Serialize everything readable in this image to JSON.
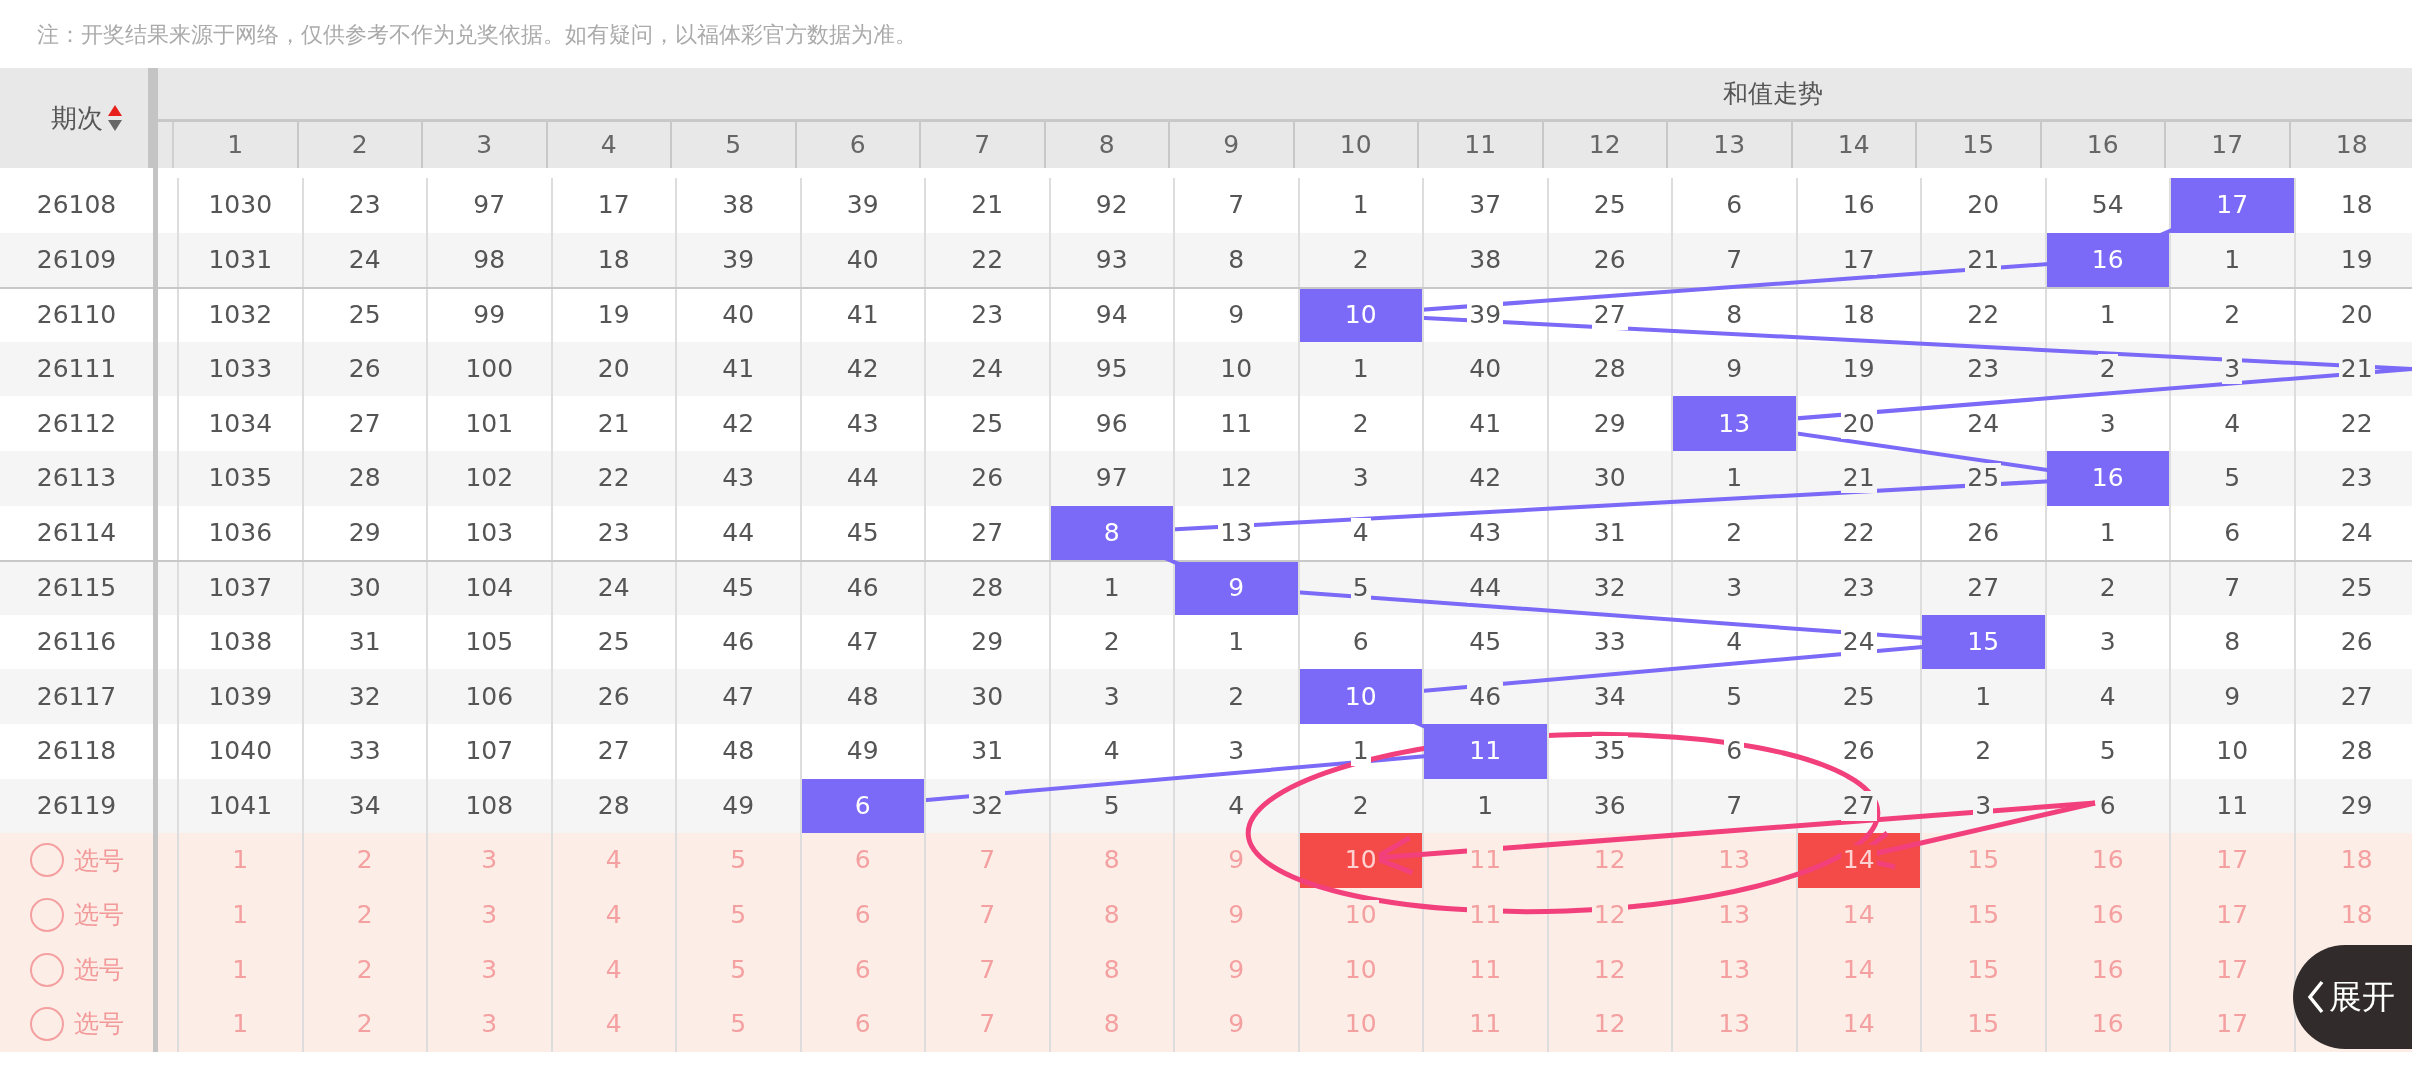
{
  "notice": "注：开奖结果来源于网络，仅供参考不作为兑奖依据。如有疑问，以福体彩官方数据为准。",
  "header": {
    "period_label": "期次",
    "sort_ascending": true,
    "group_title": "和值走势",
    "columns": [
      "1",
      "2",
      "3",
      "4",
      "5",
      "6",
      "7",
      "8",
      "9",
      "10",
      "11",
      "12",
      "13",
      "14",
      "15",
      "16",
      "17",
      "18"
    ]
  },
  "rows": [
    {
      "period": "26108",
      "separator_above": false,
      "cells": [
        "1030",
        "23",
        "97",
        "17",
        "38",
        "39",
        "21",
        "92",
        "7",
        "1",
        "37",
        "25",
        "6",
        "16",
        "20",
        "54",
        "17",
        "18"
      ],
      "hits": [
        false,
        false,
        false,
        false,
        false,
        false,
        false,
        false,
        false,
        false,
        false,
        false,
        false,
        false,
        false,
        false,
        true,
        false
      ]
    },
    {
      "period": "26109",
      "separator_above": false,
      "cells": [
        "1031",
        "24",
        "98",
        "18",
        "39",
        "40",
        "22",
        "93",
        "8",
        "2",
        "38",
        "26",
        "7",
        "17",
        "21",
        "16",
        "1",
        "19"
      ],
      "hits": [
        false,
        false,
        false,
        false,
        false,
        false,
        false,
        false,
        false,
        false,
        false,
        false,
        false,
        false,
        false,
        true,
        false,
        false
      ]
    },
    {
      "period": "26110",
      "separator_above": true,
      "cells": [
        "1032",
        "25",
        "99",
        "19",
        "40",
        "41",
        "23",
        "94",
        "9",
        "10",
        "39",
        "27",
        "8",
        "18",
        "22",
        "1",
        "2",
        "20"
      ],
      "hits": [
        false,
        false,
        false,
        false,
        false,
        false,
        false,
        false,
        false,
        true,
        false,
        false,
        false,
        false,
        false,
        false,
        false,
        false
      ]
    },
    {
      "period": "26111",
      "separator_above": false,
      "cells": [
        "1033",
        "26",
        "100",
        "20",
        "41",
        "42",
        "24",
        "95",
        "10",
        "1",
        "40",
        "28",
        "9",
        "19",
        "23",
        "2",
        "3",
        "21"
      ],
      "hits": [
        false,
        false,
        false,
        false,
        false,
        false,
        false,
        false,
        false,
        false,
        false,
        false,
        false,
        false,
        false,
        false,
        false,
        false
      ]
    },
    {
      "period": "26112",
      "separator_above": false,
      "cells": [
        "1034",
        "27",
        "101",
        "21",
        "42",
        "43",
        "25",
        "96",
        "11",
        "2",
        "41",
        "29",
        "13",
        "20",
        "24",
        "3",
        "4",
        "22"
      ],
      "hits": [
        false,
        false,
        false,
        false,
        false,
        false,
        false,
        false,
        false,
        false,
        false,
        false,
        true,
        false,
        false,
        false,
        false,
        false
      ]
    },
    {
      "period": "26113",
      "separator_above": false,
      "cells": [
        "1035",
        "28",
        "102",
        "22",
        "43",
        "44",
        "26",
        "97",
        "12",
        "3",
        "42",
        "30",
        "1",
        "21",
        "25",
        "16",
        "5",
        "23"
      ],
      "hits": [
        false,
        false,
        false,
        false,
        false,
        false,
        false,
        false,
        false,
        false,
        false,
        false,
        false,
        false,
        false,
        true,
        false,
        false
      ]
    },
    {
      "period": "26114",
      "separator_above": false,
      "cells": [
        "1036",
        "29",
        "103",
        "23",
        "44",
        "45",
        "27",
        "8",
        "13",
        "4",
        "43",
        "31",
        "2",
        "22",
        "26",
        "1",
        "6",
        "24"
      ],
      "hits": [
        false,
        false,
        false,
        false,
        false,
        false,
        false,
        true,
        false,
        false,
        false,
        false,
        false,
        false,
        false,
        false,
        false,
        false
      ]
    },
    {
      "period": "26115",
      "separator_above": true,
      "cells": [
        "1037",
        "30",
        "104",
        "24",
        "45",
        "46",
        "28",
        "1",
        "9",
        "5",
        "44",
        "32",
        "3",
        "23",
        "27",
        "2",
        "7",
        "25"
      ],
      "hits": [
        false,
        false,
        false,
        false,
        false,
        false,
        false,
        false,
        true,
        false,
        false,
        false,
        false,
        false,
        false,
        false,
        false,
        false
      ]
    },
    {
      "period": "26116",
      "separator_above": false,
      "cells": [
        "1038",
        "31",
        "105",
        "25",
        "46",
        "47",
        "29",
        "2",
        "1",
        "6",
        "45",
        "33",
        "4",
        "24",
        "15",
        "3",
        "8",
        "26"
      ],
      "hits": [
        false,
        false,
        false,
        false,
        false,
        false,
        false,
        false,
        false,
        false,
        false,
        false,
        false,
        false,
        true,
        false,
        false,
        false
      ]
    },
    {
      "period": "26117",
      "separator_above": false,
      "cells": [
        "1039",
        "32",
        "106",
        "26",
        "47",
        "48",
        "30",
        "3",
        "2",
        "10",
        "46",
        "34",
        "5",
        "25",
        "1",
        "4",
        "9",
        "27"
      ],
      "hits": [
        false,
        false,
        false,
        false,
        false,
        false,
        false,
        false,
        false,
        true,
        false,
        false,
        false,
        false,
        false,
        false,
        false,
        false
      ]
    },
    {
      "period": "26118",
      "separator_above": false,
      "cells": [
        "1040",
        "33",
        "107",
        "27",
        "48",
        "49",
        "31",
        "4",
        "3",
        "1",
        "11",
        "35",
        "6",
        "26",
        "2",
        "5",
        "10",
        "28"
      ],
      "hits": [
        false,
        false,
        false,
        false,
        false,
        false,
        false,
        false,
        false,
        false,
        true,
        false,
        false,
        false,
        false,
        false,
        false,
        false
      ]
    },
    {
      "period": "26119",
      "separator_above": false,
      "cells": [
        "1041",
        "34",
        "108",
        "28",
        "49",
        "6",
        "32",
        "5",
        "4",
        "2",
        "1",
        "36",
        "7",
        "27",
        "3",
        "6",
        "11",
        "29"
      ],
      "hits": [
        false,
        false,
        false,
        false,
        false,
        true,
        false,
        false,
        false,
        false,
        false,
        false,
        false,
        false,
        false,
        false,
        false,
        false
      ]
    }
  ],
  "pick_rows": [
    {
      "label": "选号",
      "checked": false,
      "numbers": [
        "1",
        "2",
        "3",
        "4",
        "5",
        "6",
        "7",
        "8",
        "9",
        "10",
        "11",
        "12",
        "13",
        "14",
        "15",
        "16",
        "17",
        "18"
      ],
      "selected": [
        false,
        false,
        false,
        false,
        false,
        false,
        false,
        false,
        false,
        true,
        false,
        false,
        false,
        true,
        false,
        false,
        false,
        false
      ]
    },
    {
      "label": "选号",
      "checked": false,
      "numbers": [
        "1",
        "2",
        "3",
        "4",
        "5",
        "6",
        "7",
        "8",
        "9",
        "10",
        "11",
        "12",
        "13",
        "14",
        "15",
        "16",
        "17",
        "18"
      ],
      "selected": [
        false,
        false,
        false,
        false,
        false,
        false,
        false,
        false,
        false,
        false,
        false,
        false,
        false,
        false,
        false,
        false,
        false,
        false
      ]
    },
    {
      "label": "选号",
      "checked": false,
      "numbers": [
        "1",
        "2",
        "3",
        "4",
        "5",
        "6",
        "7",
        "8",
        "9",
        "10",
        "11",
        "12",
        "13",
        "14",
        "15",
        "16",
        "17"
      ],
      "selected": [
        false,
        false,
        false,
        false,
        false,
        false,
        false,
        false,
        false,
        false,
        false,
        false,
        false,
        false,
        false,
        false,
        false
      ]
    },
    {
      "label": "选号",
      "checked": false,
      "numbers": [
        "1",
        "2",
        "3",
        "4",
        "5",
        "6",
        "7",
        "8",
        "9",
        "10",
        "11",
        "12",
        "13",
        "14",
        "15",
        "16",
        "17"
      ],
      "selected": [
        false,
        false,
        false,
        false,
        false,
        false,
        false,
        false,
        false,
        false,
        false,
        false,
        false,
        false,
        false,
        false,
        false
      ]
    }
  ],
  "expand_button": {
    "label": "展开"
  }
}
